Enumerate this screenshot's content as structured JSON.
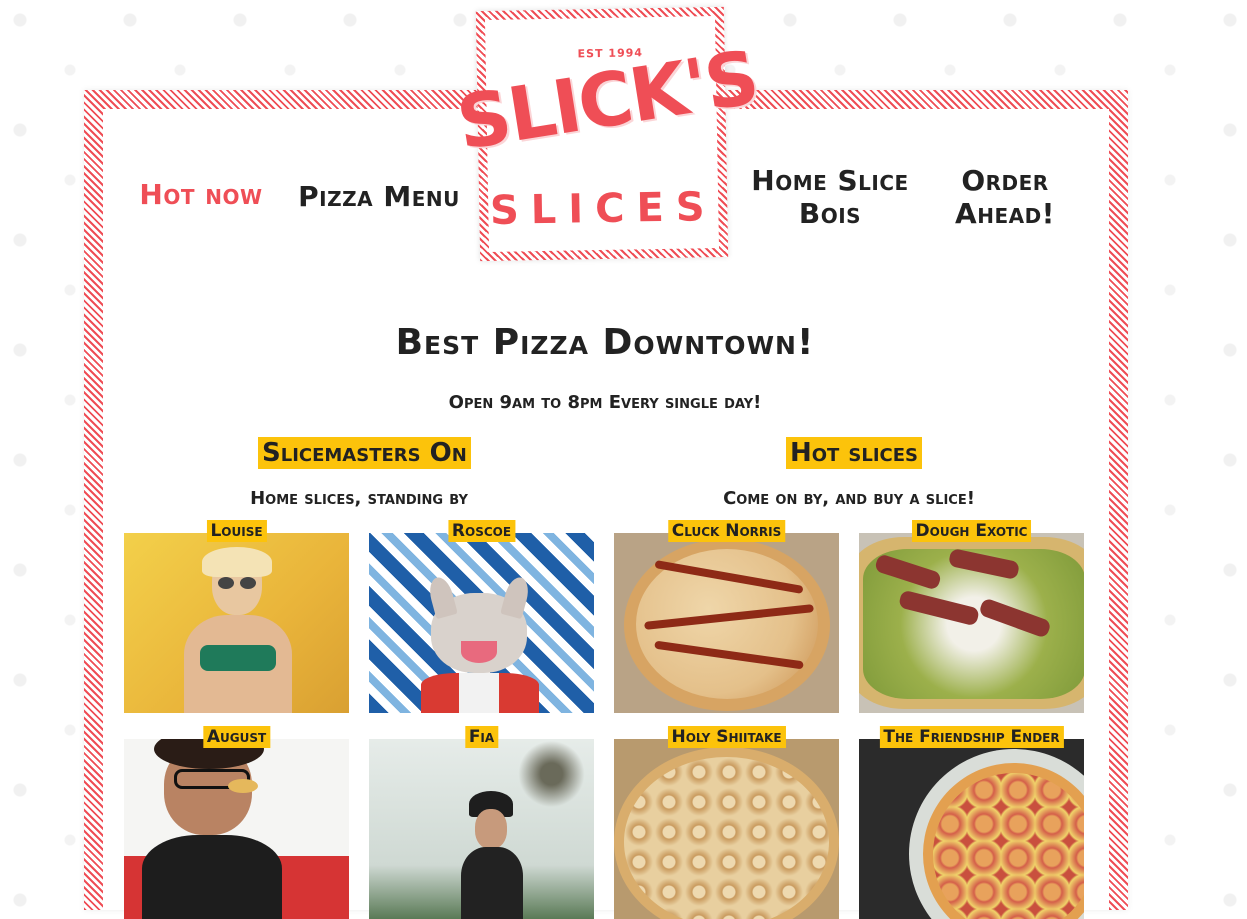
{
  "nav": {
    "hot_now": "Hot now",
    "pizza_menu": "Pizza Menu",
    "home_slice_bois": "Home Slice Bois",
    "order_ahead": "Order Ahead!"
  },
  "logo": {
    "est": "EST 1994",
    "name": "SLICK'S",
    "sub": "SLICES"
  },
  "hero": {
    "headline": "Best Pizza Downtown!",
    "hours": "Open 9am to 8pm Every single day!"
  },
  "slicemasters": {
    "title": "Slicemasters On",
    "subtitle": "Home slices, standing by",
    "people": [
      {
        "name": "Louise"
      },
      {
        "name": "Roscoe"
      },
      {
        "name": "August"
      },
      {
        "name": "Fia"
      }
    ]
  },
  "hot_slices": {
    "title": "Hot slices",
    "subtitle": "Come on by, and buy a slice!",
    "pizzas": [
      {
        "name": "Cluck Norris"
      },
      {
        "name": "Dough Exotic"
      },
      {
        "name": "Holy Shiitake"
      },
      {
        "name": "The Friendship Ender"
      }
    ]
  },
  "colors": {
    "brand_red": "#ef4e56",
    "highlight_yellow": "#fcc30b",
    "text_dark": "#222222"
  }
}
